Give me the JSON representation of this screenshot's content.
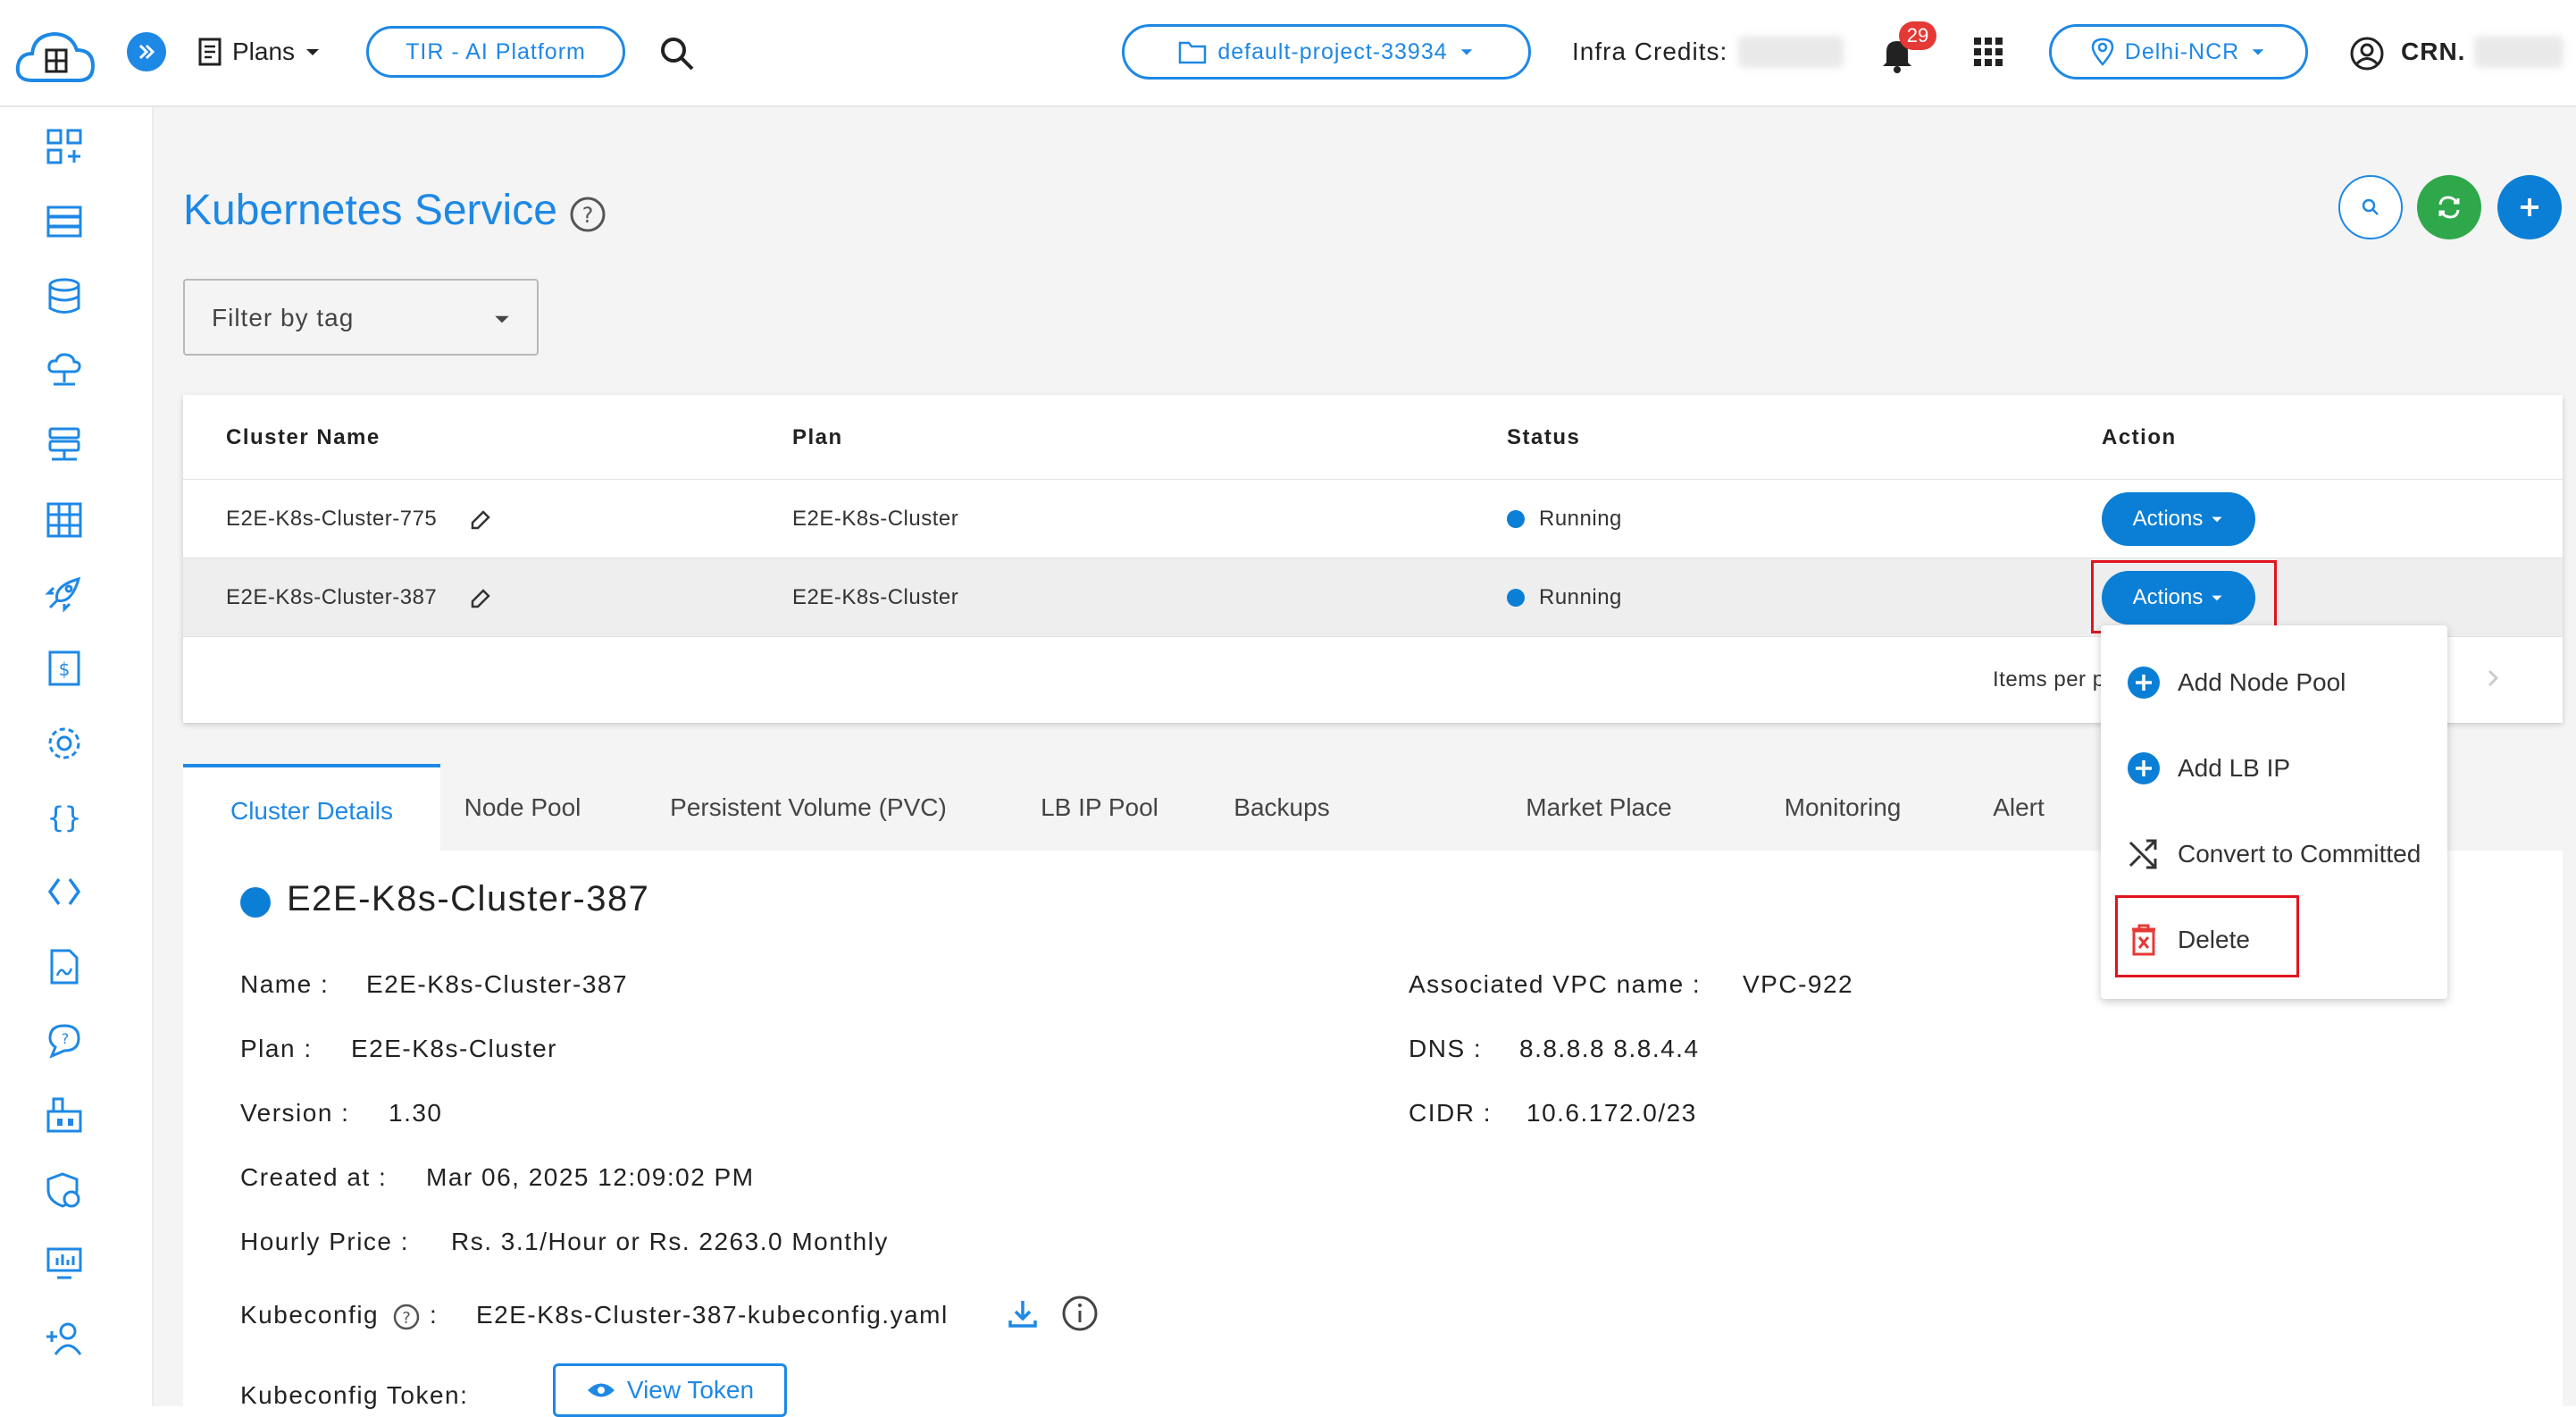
{
  "header": {
    "plans_label": "Plans",
    "tir_label": "TIR - AI Platform",
    "project_label": "default-project-33934",
    "infra_credits_label": "Infra Credits:",
    "notification_count": "29",
    "region_label": "Delhi-NCR",
    "crn_label": "CRN."
  },
  "sidebar": {
    "icons": [
      "dashboard-icon",
      "servers-icon",
      "database-icon",
      "cloud-network-icon",
      "storage-icon",
      "grid-icon",
      "rocket-icon",
      "billing-icon",
      "settings-icon",
      "braces-icon",
      "code-icon",
      "document-icon",
      "chat-icon",
      "marketplace-icon",
      "security-icon",
      "monitor-icon",
      "add-user-icon"
    ]
  },
  "page": {
    "title": "Kubernetes Service",
    "filter_placeholder": "Filter by tag"
  },
  "table": {
    "headers": [
      "Cluster Name",
      "Plan",
      "Status",
      "Action"
    ],
    "rows": [
      {
        "name": "E2E-K8s-Cluster-775",
        "plan": "E2E-K8s-Cluster",
        "status": "Running",
        "action": "Actions"
      },
      {
        "name": "E2E-K8s-Cluster-387",
        "plan": "E2E-K8s-Cluster",
        "status": "Running",
        "action": "Actions"
      }
    ],
    "items_per_page_label": "Items per p"
  },
  "actions_menu": {
    "items": [
      "Add Node Pool",
      "Add LB IP",
      "Convert to Committed",
      "Delete"
    ]
  },
  "tabs": [
    "Cluster Details",
    "Node Pool",
    "Persistent Volume (PVC)",
    "LB IP Pool",
    "Backups",
    "Market Place",
    "Monitoring",
    "Alert"
  ],
  "details": {
    "cluster_title": "E2E-K8s-Cluster-387",
    "name_label": "Name :",
    "name_value": "E2E-K8s-Cluster-387",
    "plan_label": "Plan :",
    "plan_value": "E2E-K8s-Cluster",
    "version_label": "Version :",
    "version_value": "1.30",
    "created_label": "Created at :",
    "created_value": "Mar 06, 2025 12:09:02 PM",
    "price_label": "Hourly Price :",
    "price_value": "Rs. 3.1/Hour or Rs. 2263.0 Monthly",
    "kubeconfig_label": "Kubeconfig",
    "kubeconfig_colon": ":",
    "kubeconfig_value": "E2E-K8s-Cluster-387-kubeconfig.yaml",
    "token_label": "Kubeconfig Token:",
    "view_token_label": "View Token",
    "vpc_label": "Associated VPC name :",
    "vpc_value": "VPC-922",
    "dns_label": "DNS :",
    "dns_value": "8.8.8.8 8.8.4.4",
    "cidr_label": "CIDR :",
    "cidr_value": "10.6.172.0/23"
  },
  "colors": {
    "accent": "#1e88e5",
    "action_button": "#0b7fd6",
    "refresh_green": "#2ea84a",
    "badge_red": "#e53935",
    "highlight_red": "#e0141e"
  }
}
